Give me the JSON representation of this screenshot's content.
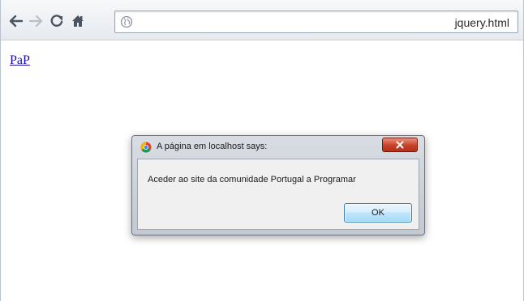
{
  "browser": {
    "nav": {
      "back_icon": "arrow-left-icon",
      "forward_icon": "arrow-right-icon",
      "reload_icon": "reload-icon",
      "home_icon": "home-icon"
    },
    "omnibox": {
      "icon": "globe-icon",
      "url": "jquery.html"
    }
  },
  "page": {
    "link_text": "PaP"
  },
  "dialog": {
    "title": "A página em localhost says:",
    "message": "Aceder ao site da comunidade Portugal a Programar",
    "ok_label": "OK",
    "close_icon": "close-icon"
  },
  "colors": {
    "link": "#1a0dab",
    "close_button": "#c7412a",
    "ok_button_border": "#3c7fb1"
  }
}
